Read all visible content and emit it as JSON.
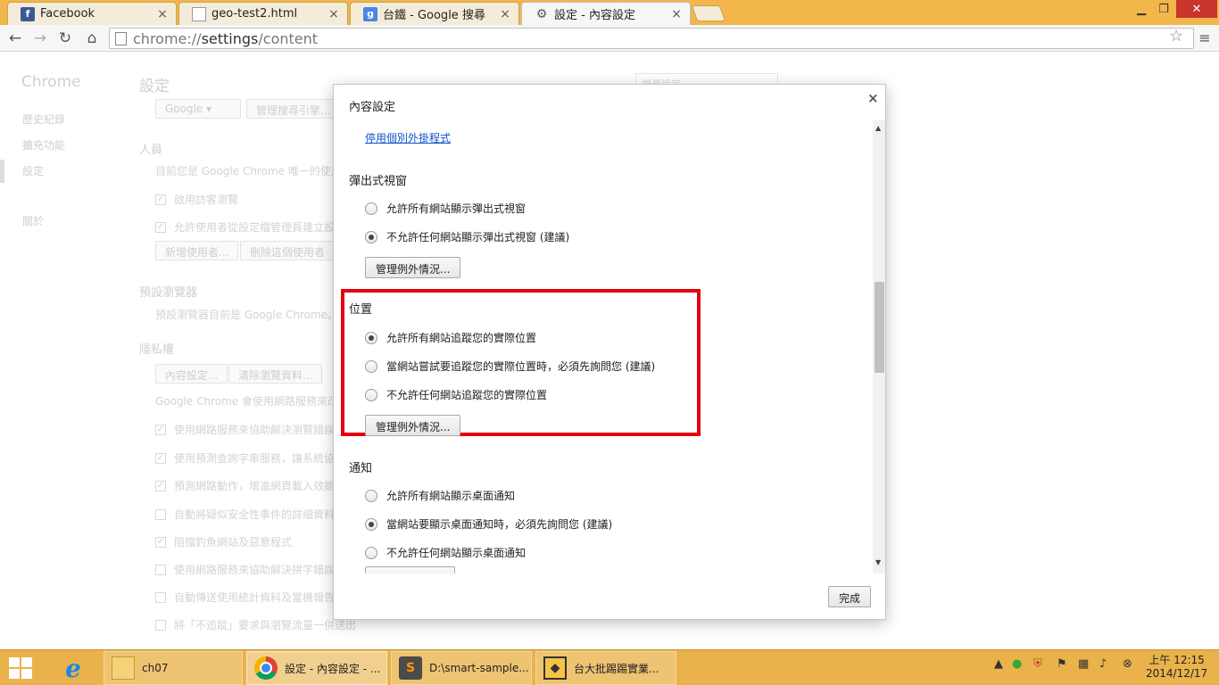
{
  "tabs": [
    {
      "title": "Facebook",
      "icon": "facebook-favicon"
    },
    {
      "title": "geo-test2.html",
      "icon": "document-favicon"
    },
    {
      "title": "台鐵 - Google 搜尋",
      "icon": "google-favicon"
    },
    {
      "title": "設定 - 內容設定",
      "icon": "settings-gear-favicon"
    }
  ],
  "omnibox": {
    "url_prefix": "chrome://",
    "url_host": "settings",
    "url_path": "/content"
  },
  "background": {
    "brand": "Chrome",
    "sidebar": [
      "歷史紀錄",
      "擴充功能",
      "設定",
      "關於"
    ],
    "page_title": "設定",
    "search_placeholder": "搜尋設定",
    "search_engine": "Google",
    "manage_search": "管理搜尋引擎...",
    "people_heading": "人員",
    "people_text": "目前您是 Google Chrome 唯一的使用",
    "people_opts": [
      "啟用訪客瀏覽",
      "允許使用者從設定檔管理員建立設"
    ],
    "add_user": "新增使用者...",
    "remove_user": "刪除這個使用者",
    "default_browser_heading": "預設瀏覽器",
    "default_browser_text": "預設瀏覽器目前是 Google Chrome。",
    "privacy_heading": "隱私權",
    "content_settings_btn": "內容設定...",
    "clear_data_btn": "清除瀏覽資料...",
    "privacy_text": "Google Chrome 會使用網路服務來改善",
    "privacy_opts": [
      "使用網路服務來協助解決瀏覽錯誤",
      "使用預測查詢字串服務，讓系統協",
      "預測網路動作，增進網頁載入效能",
      "自動將疑似安全性事件的詳細資料",
      "阻擋釣魚網站及惡意程式",
      "使用網路服務來協助解決拼字錯誤",
      "自動傳送使用統計資料及當機報告",
      "將「不追蹤」要求與瀏覽流量一併送出"
    ]
  },
  "dialog": {
    "title": "內容設定",
    "close": "×",
    "plugin_link": "停用個別外掛程式",
    "popups": {
      "heading": "彈出式視窗",
      "options": [
        "允許所有網站顯示彈出式視窗",
        "不允許任何網站顯示彈出式視窗 (建議)"
      ],
      "manage": "管理例外情況..."
    },
    "location": {
      "heading": "位置",
      "options": [
        "允許所有網站追蹤您的實際位置",
        "當網站嘗試要追蹤您的實際位置時，必須先詢問您 (建議)",
        "不允許任何網站追蹤您的實際位置"
      ],
      "manage": "管理例外情況..."
    },
    "notifications": {
      "heading": "通知",
      "options": [
        "允許所有網站顯示桌面通知",
        "當網站要顯示桌面通知時，必須先詢問您 (建議)",
        "不允許任何網站顯示桌面通知"
      ]
    },
    "done": "完成"
  },
  "taskbar": {
    "items": [
      "ch07",
      "設定 - 內容設定 - ...",
      "D:\\smart-sample...",
      "台大批踢踢實業..."
    ],
    "clock_time": "上午 12:15",
    "clock_date": "2014/12/17"
  },
  "colors": {
    "highlight": "#e3000f",
    "tabstrip": "#f2b64a",
    "taskbar": "#e9b24a",
    "link": "#1155cc"
  }
}
